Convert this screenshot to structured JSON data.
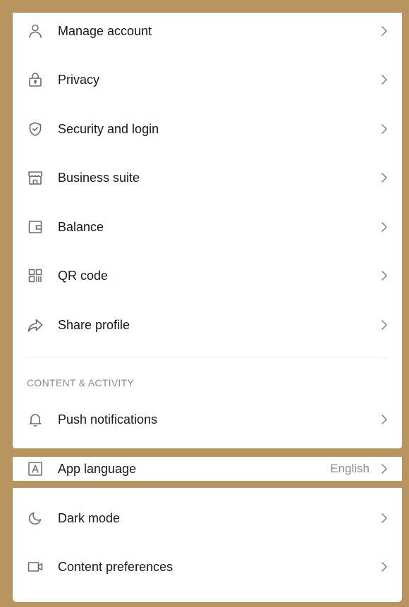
{
  "colors": {
    "frame": "#b8955e",
    "panel": "#ffffff",
    "text": "#161823",
    "muted": "#8a8b91",
    "icon": "#6b6c72"
  },
  "account_items": [
    {
      "label": "Manage account",
      "icon": "person-icon"
    },
    {
      "label": "Privacy",
      "icon": "lock-icon"
    },
    {
      "label": "Security and login",
      "icon": "shield-icon"
    },
    {
      "label": "Business suite",
      "icon": "store-icon"
    },
    {
      "label": "Balance",
      "icon": "wallet-icon"
    },
    {
      "label": "QR code",
      "icon": "qr-code-icon"
    },
    {
      "label": "Share profile",
      "icon": "share-icon"
    }
  ],
  "content_section": {
    "title": "CONTENT & ACTIVITY",
    "items": [
      {
        "label": "Push notifications",
        "icon": "bell-icon"
      }
    ]
  },
  "app_language": {
    "label": "App language",
    "value": "English",
    "icon": "language-icon"
  },
  "display_items": [
    {
      "label": "Dark mode",
      "icon": "moon-icon"
    },
    {
      "label": "Content preferences",
      "icon": "video-icon"
    }
  ]
}
